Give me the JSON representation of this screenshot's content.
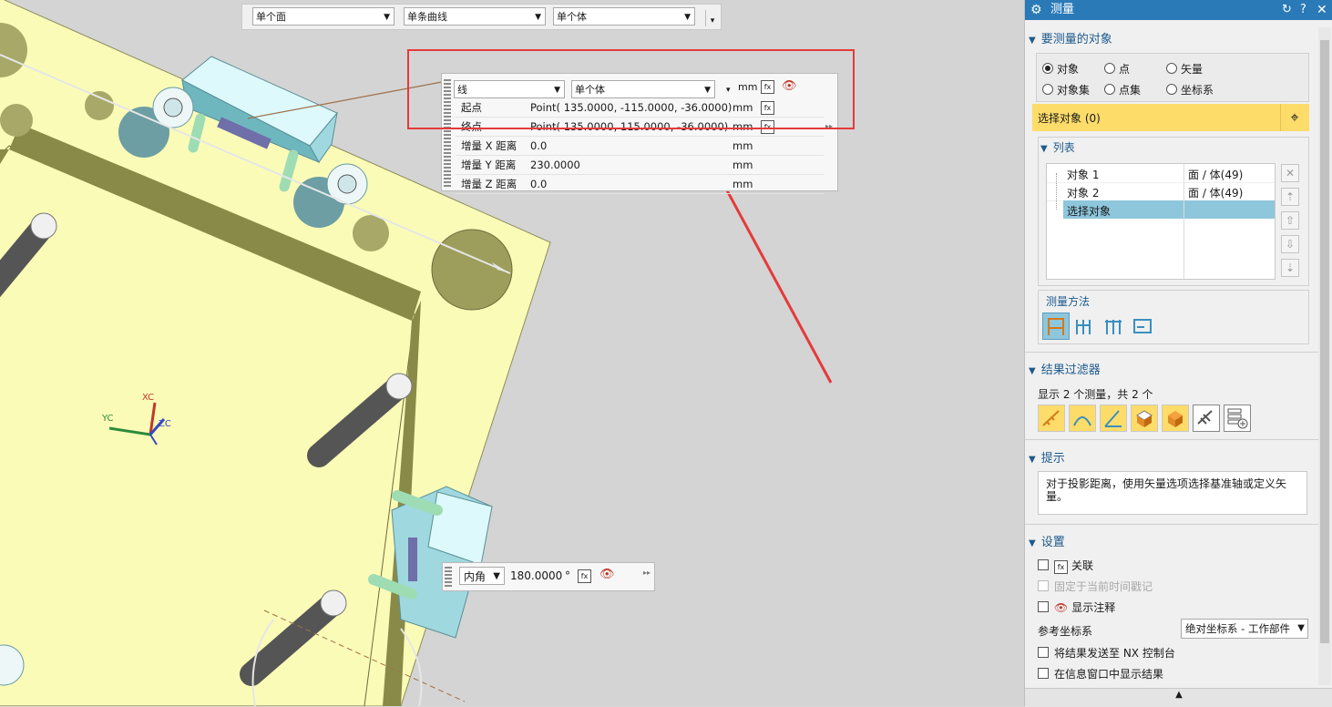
{
  "selection_bar": {
    "filter1": "单个面",
    "filter2": "单条曲线",
    "filter3": "单个体"
  },
  "float_panel": {
    "dd1": "线",
    "dd2": "单个体",
    "rows": [
      {
        "label": "起点",
        "value": "Point( 135.0000, -115.0000, -36.0000)",
        "unit": "mm"
      },
      {
        "label": "终点",
        "value": "Point( 135.0000, 115.0000, -36.0000)",
        "unit": "mm"
      },
      {
        "label": "增量 X 距离",
        "value": "0.0",
        "unit": "mm"
      },
      {
        "label": "增量 Y 距离",
        "value": "230.0000",
        "unit": "mm"
      },
      {
        "label": "增量 Z 距离",
        "value": "0.0",
        "unit": "mm"
      }
    ],
    "top_unit": "mm"
  },
  "angle_panel": {
    "label": "内角",
    "value": "180.0000",
    "unit": "°"
  },
  "triad": {
    "xc": "XC",
    "yc": "YC",
    "zc": "ZC"
  },
  "right_panel": {
    "title": "测量",
    "section_objects": "要测量的对象",
    "radios": [
      "对象",
      "点",
      "矢量",
      "对象集",
      "点集",
      "坐标系"
    ],
    "select_label": "选择对象 (0)",
    "list_section": "列表",
    "list": [
      {
        "name": "对象 1",
        "type": "面 / 体(49)"
      },
      {
        "name": "对象 2",
        "type": "面 / 体(49)"
      },
      {
        "name": "选择对象",
        "type": ""
      }
    ],
    "method_label": "测量方法",
    "section_filter": "结果过滤器",
    "filter_text": "显示 2 个测量，共 2 个",
    "section_hint": "提示",
    "hint_text": "对于投影距离，使用矢量选项选择基准轴或定义矢量。",
    "section_settings": "设置",
    "settings": {
      "associative": "关联",
      "fix_time": "固定于当前时间戳记",
      "show_annotation": "显示注释",
      "ref_csys_label": "参考坐标系",
      "ref_csys_value": "绝对坐标系 - 工作部件",
      "send_nx": "将结果发送至 NX 控制台",
      "show_info": "在信息窗口中显示结果"
    }
  },
  "colors": {
    "accent": "#2a7ab8",
    "highlight": "#fddc6a",
    "selected_row": "#8ec6dc",
    "plate": "#fbfbb8",
    "red": "#e53a3a"
  }
}
